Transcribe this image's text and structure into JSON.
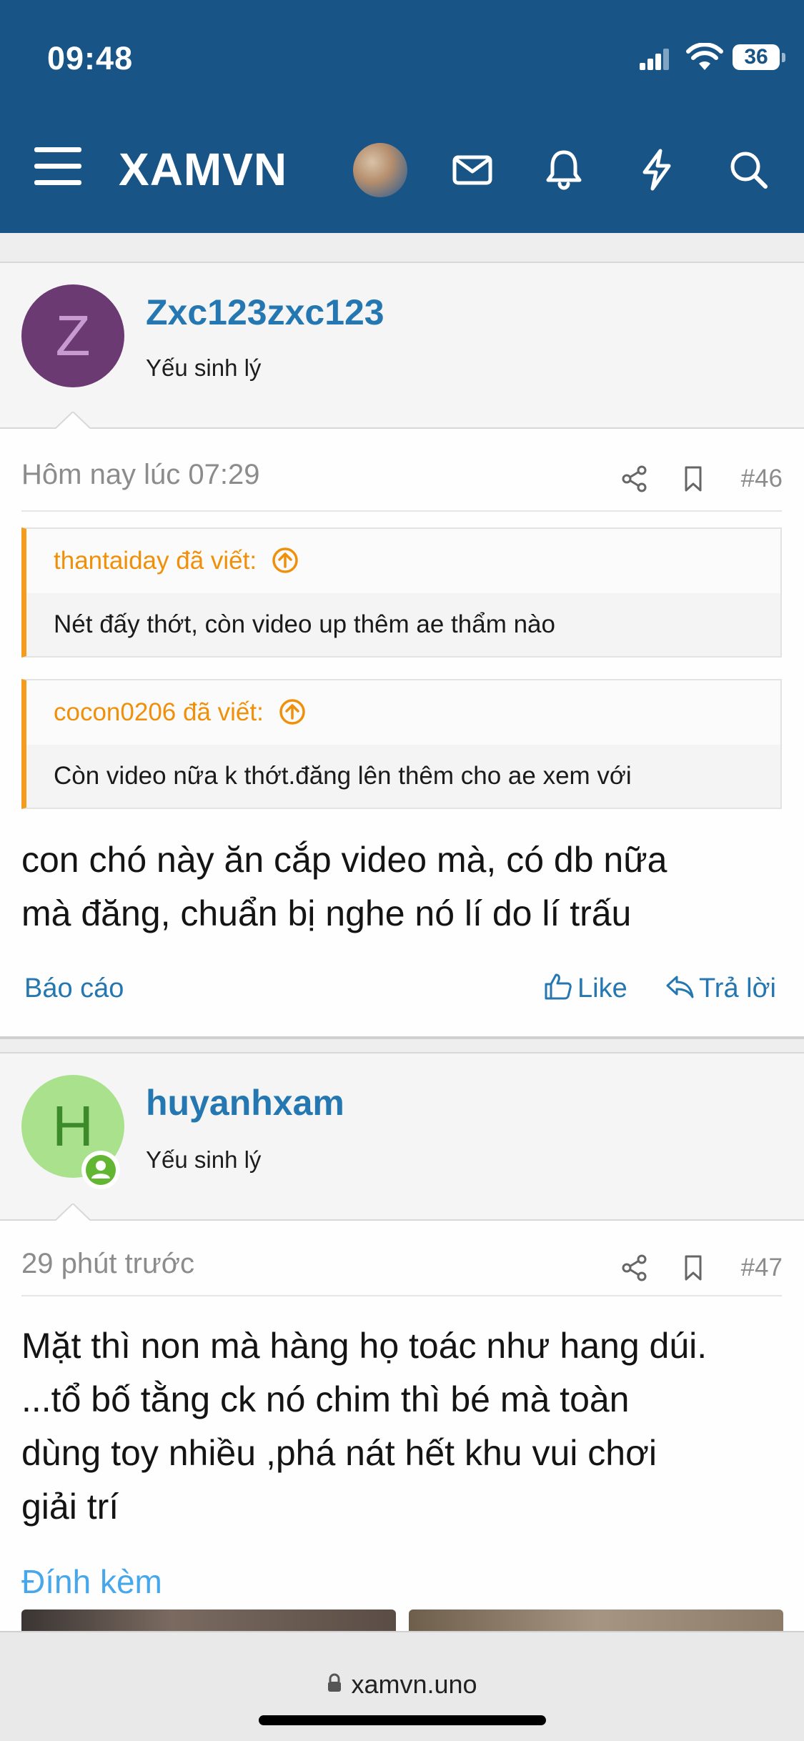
{
  "status_bar": {
    "time": "09:48",
    "battery": "36"
  },
  "header": {
    "brand": "XAMVN"
  },
  "posts": [
    {
      "avatar_letter": "Z",
      "username": "Zxc123zxc123",
      "user_title": "Yếu sinh lý",
      "date": "Hôm nay lúc 07:29",
      "number": "#46",
      "quotes": [
        {
          "author": "thantaiday đã viết:",
          "text": "Nét đấy thớt, còn video up thêm ae thẩm nào"
        },
        {
          "author": "cocon0206 đã viết:",
          "text": "Còn video nữa k thớt.đăng lên thêm cho ae xem với"
        }
      ],
      "message_lines": [
        "con chó này ăn cắp video mà, có db nữa",
        "mà đăng, chuẩn bị nghe nó lí do lí trấu"
      ],
      "actions": {
        "report": "Báo cáo",
        "like": "Like",
        "reply": "Trả lời"
      }
    },
    {
      "avatar_letter": "H",
      "username": "huyanhxam",
      "user_title": "Yếu sinh lý",
      "date": "29 phút trước",
      "number": "#47",
      "message_lines": [
        "Mặt thì non mà hàng họ toác như hang dúi.",
        "...tổ bố tằng ck nó chim thì bé mà toàn",
        "dùng toy nhiều ,phá nát hết khu vui chơi",
        "giải trí"
      ],
      "attachments_label": "Đính kèm"
    }
  ],
  "browser": {
    "url": "xamvn.uno"
  },
  "colors": {
    "header_bg": "#185486",
    "link": "#2577b1",
    "quote_accent": "#f39c1e",
    "avatar_z_bg": "#6b3a72",
    "avatar_h_bg": "#a9e18c"
  }
}
